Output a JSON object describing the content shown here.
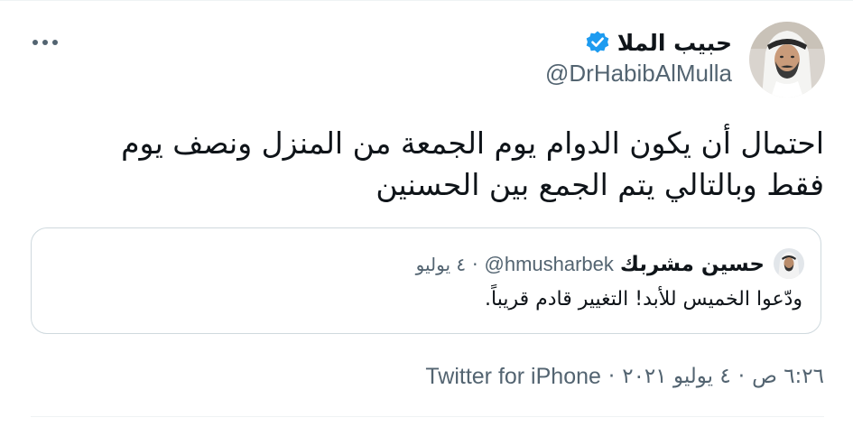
{
  "tweet": {
    "author": {
      "name": "حبيب الملا",
      "handle": "@DrHabibAlMulla",
      "verified": true,
      "avatar_icon": "user-avatar-photo"
    },
    "more_icon": "more-horizontal-icon",
    "text": "احتمال أن يكون الدوام يوم الجمعة من المنزل ونصف يوم\nفقط وبالتالي يتم الجمع بين الحسنين",
    "quoted_tweet": {
      "author_name": "حسين مشربك",
      "author_handle": "@hmusharbek",
      "separator": "·",
      "date": "٤ يوليو",
      "text": "ودّعوا الخميس للأبد! التغيير قادم قريباً."
    },
    "meta": {
      "time": "٦:٢٦ ص",
      "sep1": "·",
      "date": "٤ يوليو ٢٠٢١",
      "sep2": "·",
      "source": "Twitter for iPhone"
    },
    "colors": {
      "text_primary": "#0f1419",
      "text_secondary": "#536471",
      "verified_blue": "#1d9bf0",
      "border": "#cfd9de",
      "divider": "#eff3f4"
    }
  }
}
